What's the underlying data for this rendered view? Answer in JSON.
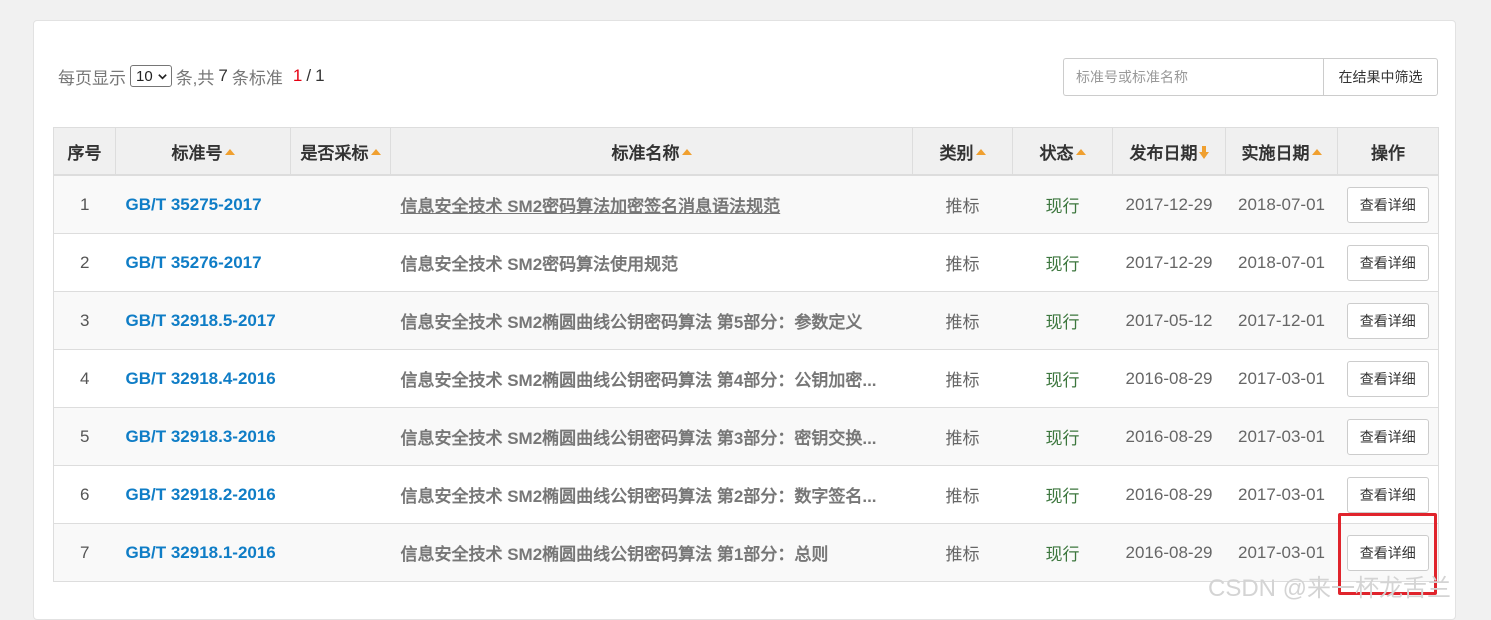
{
  "pager": {
    "prefix": "每页显示",
    "page_size": "10",
    "mid": "条,共",
    "total": "7",
    "suffix": "条标准",
    "current_page": "1",
    "separator": "/",
    "total_pages": "1"
  },
  "search": {
    "placeholder": "标准号或标准名称",
    "button_label": "在结果中筛选"
  },
  "table": {
    "headers": {
      "index": "序号",
      "code": "标准号",
      "adopted": "是否采标",
      "name": "标准名称",
      "category": "类别",
      "status": "状态",
      "publish_date": "发布日期",
      "effective_date": "实施日期",
      "action": "操作"
    },
    "rows": [
      {
        "index": "1",
        "code": "GB/T 35275-2017",
        "adopted": "",
        "name": "信息安全技术 SM2密码算法加密签名消息语法规范",
        "category": "推标",
        "status": "现行",
        "publish_date": "2017-12-29",
        "effective_date": "2018-07-01",
        "action": "查看详细"
      },
      {
        "index": "2",
        "code": "GB/T 35276-2017",
        "adopted": "",
        "name": "信息安全技术 SM2密码算法使用规范",
        "category": "推标",
        "status": "现行",
        "publish_date": "2017-12-29",
        "effective_date": "2018-07-01",
        "action": "查看详细"
      },
      {
        "index": "3",
        "code": "GB/T 32918.5-2017",
        "adopted": "",
        "name": "信息安全技术 SM2椭圆曲线公钥密码算法 第5部分：参数定义",
        "category": "推标",
        "status": "现行",
        "publish_date": "2017-05-12",
        "effective_date": "2017-12-01",
        "action": "查看详细"
      },
      {
        "index": "4",
        "code": "GB/T 32918.4-2016",
        "adopted": "",
        "name": "信息安全技术 SM2椭圆曲线公钥密码算法 第4部分：公钥加密...",
        "category": "推标",
        "status": "现行",
        "publish_date": "2016-08-29",
        "effective_date": "2017-03-01",
        "action": "查看详细"
      },
      {
        "index": "5",
        "code": "GB/T 32918.3-2016",
        "adopted": "",
        "name": "信息安全技术 SM2椭圆曲线公钥密码算法 第3部分：密钥交换...",
        "category": "推标",
        "status": "现行",
        "publish_date": "2016-08-29",
        "effective_date": "2017-03-01",
        "action": "查看详细"
      },
      {
        "index": "6",
        "code": "GB/T 32918.2-2016",
        "adopted": "",
        "name": "信息安全技术 SM2椭圆曲线公钥密码算法 第2部分：数字签名...",
        "category": "推标",
        "status": "现行",
        "publish_date": "2016-08-29",
        "effective_date": "2017-03-01",
        "action": "查看详细"
      },
      {
        "index": "7",
        "code": "GB/T 32918.1-2016",
        "adopted": "",
        "name": "信息安全技术 SM2椭圆曲线公钥密码算法 第1部分：总则",
        "category": "推标",
        "status": "现行",
        "publish_date": "2016-08-29",
        "effective_date": "2017-03-01",
        "action": "查看详细"
      }
    ]
  },
  "watermark": "CSDN @来一杯龙舌兰",
  "colors": {
    "link": "#0f7dc6",
    "status_current": "#3c763d",
    "page_current": "#e60012",
    "sort_arrow": "#f0a030",
    "highlight": "#e0242c"
  }
}
